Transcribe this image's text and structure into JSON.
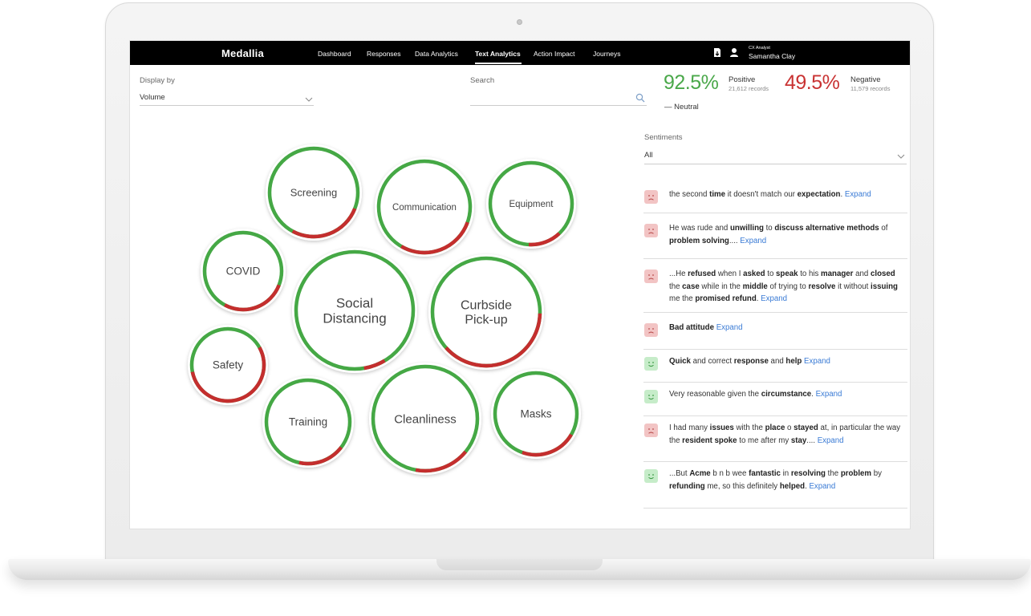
{
  "app": {
    "logo": "Medallia",
    "nav": [
      {
        "label": "Dashboard",
        "active": false
      },
      {
        "label": "Responses",
        "active": false
      },
      {
        "label": "Data Analytics",
        "active": false
      },
      {
        "label": "Text Analytics",
        "active": true
      },
      {
        "label": "Action Impact",
        "active": false
      },
      {
        "label": "Journeys",
        "active": false
      }
    ],
    "user": {
      "role": "CX Analyst",
      "name": "Samantha Clay"
    },
    "icons": [
      "export-icon",
      "user-icon"
    ]
  },
  "display_by": {
    "label": "Display by",
    "value": "Volume"
  },
  "search": {
    "label": "Search",
    "value": ""
  },
  "stats": {
    "positive": {
      "pct": "92.5%",
      "label": "Positive",
      "records": "21,612 records",
      "color": "#4aa84a"
    },
    "negative": {
      "pct": "49.5%",
      "label": "Negative",
      "records": "11,579 records",
      "color": "#c93333"
    },
    "neutral": {
      "label": "— Neutral"
    }
  },
  "sentiments": {
    "label": "Sentiments",
    "value": "All"
  },
  "colors": {
    "positive": "#45a845",
    "negative": "#c42e2e",
    "topbar": "#000000",
    "link": "#3a7bd5"
  },
  "topics": [
    {
      "label": "Screening",
      "negative_share": 0.27
    },
    {
      "label": "Communication",
      "negative_share": 0.28
    },
    {
      "label": "Equipment",
      "negative_share": 0.13
    },
    {
      "label": "COVID",
      "negative_share": 0.27
    },
    {
      "label": "Social Distancing",
      "negative_share": 0.06
    },
    {
      "label": "Curbside Pick-up",
      "negative_share": 0.38
    },
    {
      "label": "Safety",
      "negative_share": 0.55
    },
    {
      "label": "Training",
      "negative_share": 0.18
    },
    {
      "label": "Cleanliness",
      "negative_share": 0.17
    },
    {
      "label": "Masks",
      "negative_share": 0.22
    }
  ],
  "comments": [
    {
      "sentiment": "negative",
      "html": "the second <b>time</b> it doesn't match our <b>expectation</b>.",
      "expand": "Expand"
    },
    {
      "sentiment": "negative",
      "html": "He was rude and <b>unwilling</b> to <b>discuss alternative methods</b> of <b>problem solving</b>....",
      "expand": "Expand"
    },
    {
      "sentiment": "negative",
      "html": "...He <b>refused</b> when I <b>asked</b> to <b>speak</b> to his <b>manager</b> and <b>closed</b> the <b>case</b> while in the <b>middle</b> of trying to <b>resolve</b> it without <b>issuing</b> me the <b>promised refund</b>.",
      "expand": "Expand"
    },
    {
      "sentiment": "negative",
      "html": "<b>Bad attitude</b>",
      "expand": "Expand"
    },
    {
      "sentiment": "positive",
      "html": "<b>Quick</b> and correct <b>response</b> and <b>help</b>",
      "expand": "Expand"
    },
    {
      "sentiment": "positive",
      "html": "Very reasonable given the <b>circumstance</b>.",
      "expand": "Expand"
    },
    {
      "sentiment": "negative",
      "html": "I had many <b>issues</b> with the <b>place</b> o <b>stayed</b> at, in particular the way the <b>resident spoke</b> to me after my <b>stay</b>....",
      "expand": "Expand"
    },
    {
      "sentiment": "positive",
      "html": "...But <b>Acme</b> b n b wee <b>fantastic</b> in <b>resolving</b> the <b>problem</b> by <b>refunding</b> me, so this definitely <b>helped</b>.",
      "expand": "Expand"
    }
  ]
}
